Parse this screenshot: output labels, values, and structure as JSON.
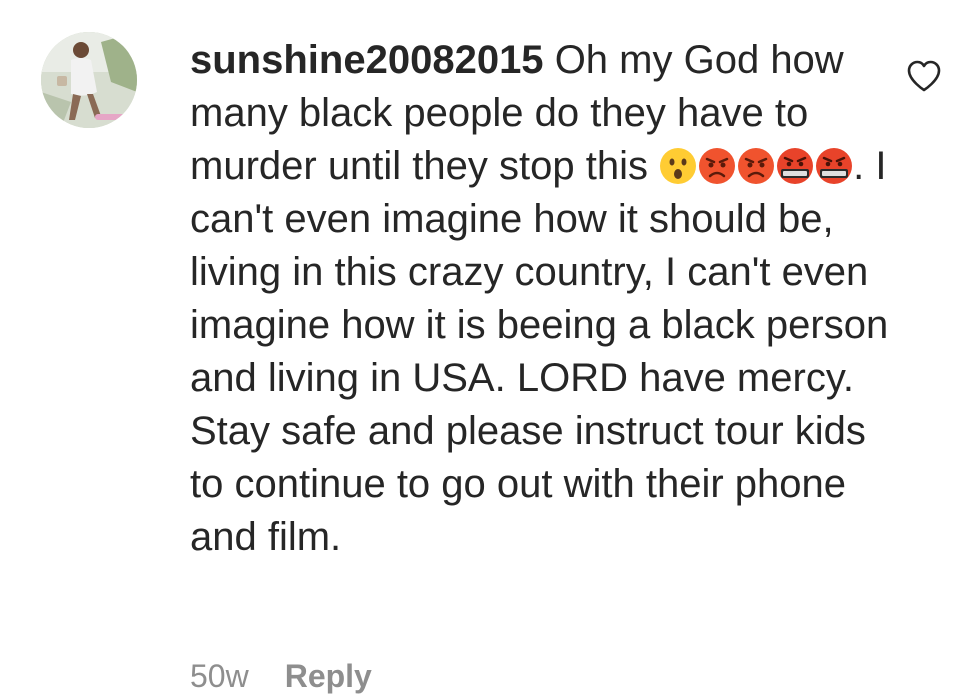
{
  "comment": {
    "username": "sunshine20082015",
    "text_before_emoji": "Oh my God how many black people do they have to murder until they stop this",
    "emojis": [
      "face-with-open-mouth-emoji",
      "pouting-face-emoji",
      "pouting-face-emoji",
      "face-with-symbols-on-mouth-emoji",
      "face-with-symbols-on-mouth-emoji"
    ],
    "text_after_emoji": ". I can't even imagine how it should be, living in this crazy country, I can't even imagine how it is beeing a black person and living in USA. LORD have mercy. Stay safe and please instruct tour kids to continue to go out with their phone and film.",
    "age": "50w",
    "reply_label": "Reply"
  },
  "icons": {
    "like": "heart-outline-icon"
  },
  "colors": {
    "text": "#262626",
    "meta": "#8e8e8e"
  }
}
